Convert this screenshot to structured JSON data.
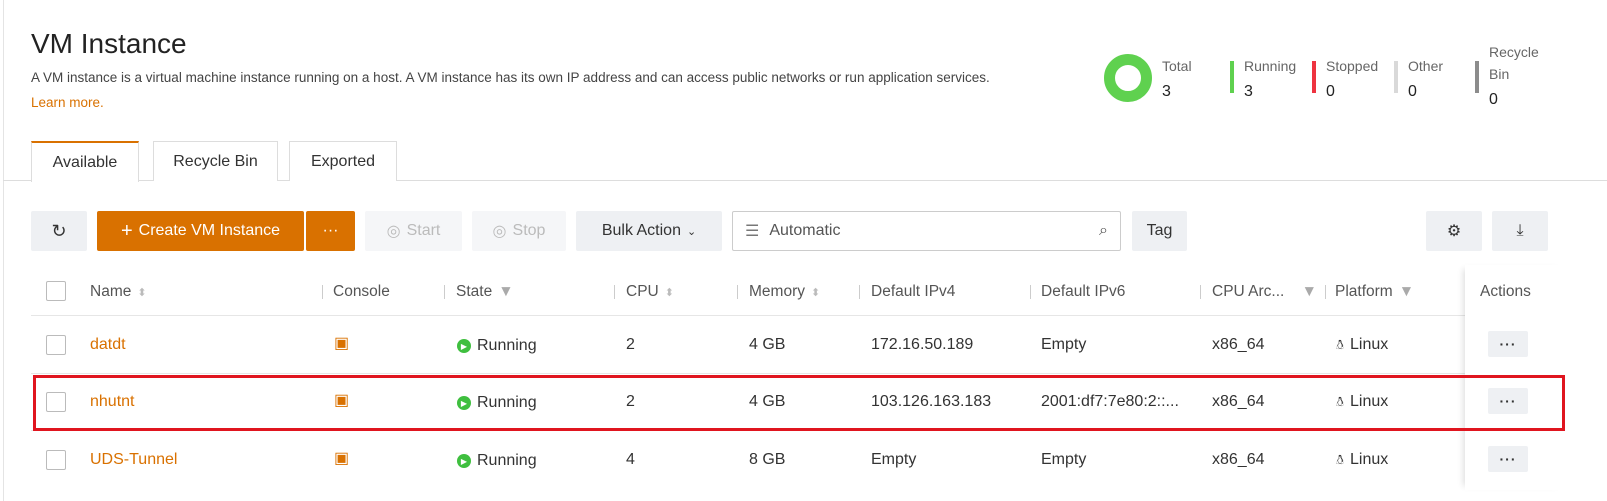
{
  "page": {
    "title": "VM Instance",
    "description": "A VM instance is a virtual machine instance running on a host. A VM instance has its own IP address and can access public networks or run application services.",
    "learn_more": "Learn more."
  },
  "stats": [
    {
      "label": "Total",
      "value": "3",
      "color": "#5fd14f"
    },
    {
      "label": "Running",
      "value": "3",
      "color": "#5fd14f"
    },
    {
      "label": "Stopped",
      "value": "0",
      "color": "#ee3340"
    },
    {
      "label": "Other",
      "value": "0",
      "color": "#d9d9d9"
    },
    {
      "label": "Recycle Bin",
      "value": "0",
      "color": "#8c8c8c"
    }
  ],
  "tabs": [
    "Available",
    "Recycle Bin",
    "Exported"
  ],
  "toolbar": {
    "create": "Create VM Instance",
    "more": "···",
    "start": "Start",
    "stop": "Stop",
    "bulk": "Bulk Action",
    "search": "Automatic",
    "tag": "Tag"
  },
  "columns": [
    "Name",
    "Console",
    "State",
    "CPU",
    "Memory",
    "Default IPv4",
    "Default IPv6",
    "CPU Arc...",
    "Platform",
    "Actions"
  ],
  "rows": [
    {
      "name": "datdt",
      "state": "Running",
      "cpu": "2",
      "memory": "4 GB",
      "ipv4": "172.16.50.189",
      "ipv6": "Empty",
      "arch": "x86_64",
      "platform": "Linux"
    },
    {
      "name": "nhutnt",
      "state": "Running",
      "cpu": "2",
      "memory": "4 GB",
      "ipv4": "103.126.163.183",
      "ipv6": "2001:df7:7e80:2::...",
      "arch": "x86_64",
      "platform": "Linux"
    },
    {
      "name": "UDS-Tunnel",
      "state": "Running",
      "cpu": "4",
      "memory": "8 GB",
      "ipv4": "Empty",
      "ipv6": "Empty",
      "arch": "x86_64",
      "platform": "Linux"
    }
  ],
  "actions_label": "···"
}
